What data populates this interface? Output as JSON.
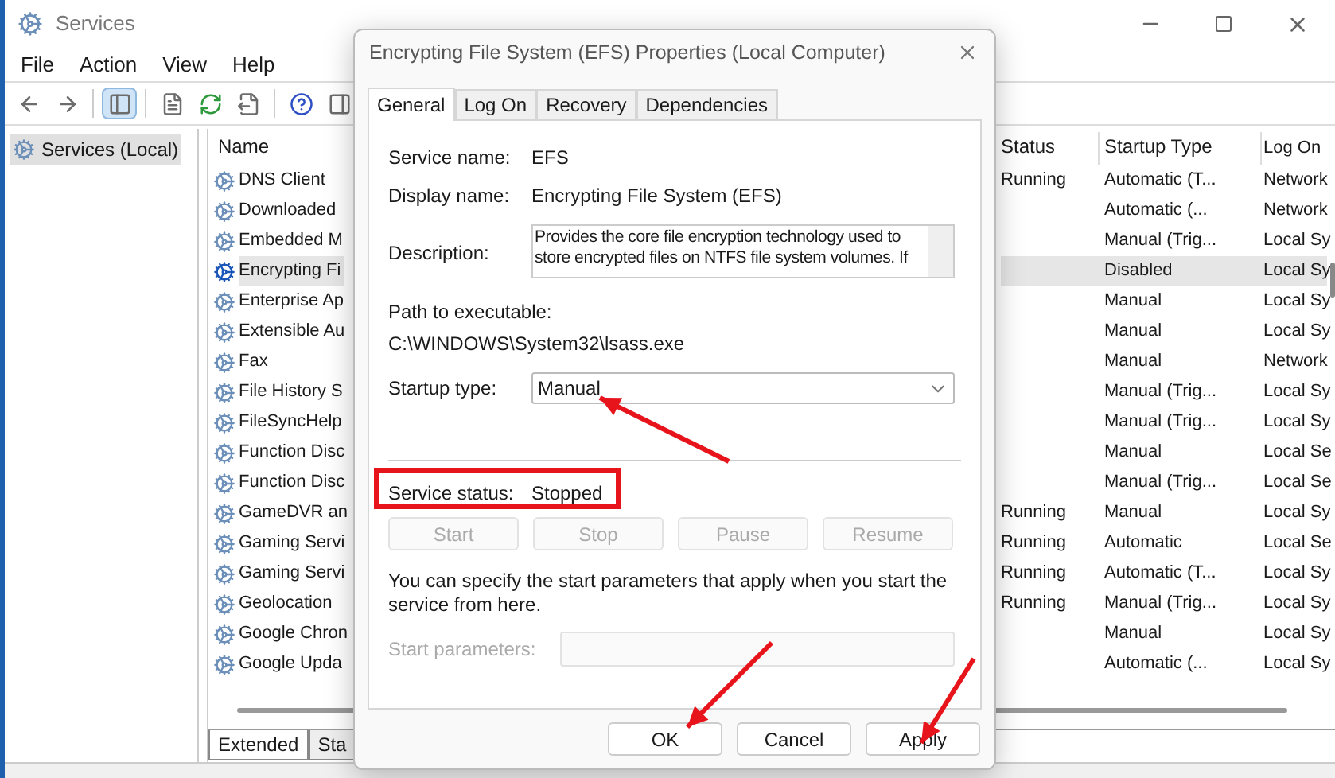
{
  "window": {
    "title": "Services"
  },
  "menu": [
    "File",
    "Action",
    "View",
    "Help"
  ],
  "toolbar": [
    {
      "kind": "back",
      "selected": false
    },
    {
      "kind": "forward",
      "selected": false
    },
    {
      "kind": "separator"
    },
    {
      "kind": "console-tree",
      "selected": true
    },
    {
      "kind": "separator"
    },
    {
      "kind": "properties",
      "selected": false
    },
    {
      "kind": "refresh",
      "selected": false
    },
    {
      "kind": "export",
      "selected": false
    },
    {
      "kind": "separator"
    },
    {
      "kind": "help",
      "selected": false
    },
    {
      "kind": "action-pane",
      "selected": false
    }
  ],
  "tree": [
    {
      "label": "Services (Local)",
      "selected": true
    }
  ],
  "table": {
    "columns": [
      "Name",
      "Status",
      "Startup Type",
      "Log On"
    ],
    "rows": [
      {
        "name": "DNS Client",
        "status": "Running",
        "startup_type": "Automatic (T...",
        "log_on": "Network",
        "selected": false
      },
      {
        "name": "Downloaded",
        "startup_type": "Automatic (...",
        "log_on": "Network",
        "selected": false
      },
      {
        "name": "Embedded M",
        "startup_type": "Manual (Trig...",
        "log_on": "Local Sy",
        "selected": false
      },
      {
        "name": "Encrypting Fi",
        "startup_type": "Disabled",
        "log_on": "Local Sy",
        "selected": true
      },
      {
        "name": "Enterprise Ap",
        "startup_type": "Manual",
        "log_on": "Local Sy",
        "selected": false
      },
      {
        "name": "Extensible Au",
        "startup_type": "Manual",
        "log_on": "Local Sy",
        "selected": false
      },
      {
        "name": "Fax",
        "startup_type": "Manual",
        "log_on": "Network",
        "selected": false
      },
      {
        "name": "File History S",
        "startup_type": "Manual (Trig...",
        "log_on": "Local Sy",
        "selected": false
      },
      {
        "name": "FileSyncHelp",
        "startup_type": "Manual (Trig...",
        "log_on": "Local Sy",
        "selected": false
      },
      {
        "name": "Function Disc",
        "startup_type": "Manual",
        "log_on": "Local Se",
        "selected": false
      },
      {
        "name": "Function Disc",
        "startup_type": "Manual (Trig...",
        "log_on": "Local Se",
        "selected": false
      },
      {
        "name": "GameDVR an",
        "status": "Running",
        "startup_type": "Manual",
        "log_on": "Local Sy",
        "selected": false
      },
      {
        "name": "Gaming Servi",
        "status": "Running",
        "startup_type": "Automatic",
        "log_on": "Local Se",
        "selected": false
      },
      {
        "name": "Gaming Servi",
        "status": "Running",
        "startup_type": "Automatic (T...",
        "log_on": "Local Sy",
        "selected": false
      },
      {
        "name": "Geolocation",
        "status": "Running",
        "startup_type": "Manual (Trig...",
        "log_on": "Local Sy",
        "selected": false
      },
      {
        "name": "Google Chron",
        "startup_type": "Manual",
        "log_on": "Local Sy",
        "selected": false
      },
      {
        "name": "Google Upda",
        "startup_type": "Automatic (...",
        "log_on": "Local Sy",
        "selected": false
      }
    ]
  },
  "view_tabs": [
    {
      "label": "Extended",
      "selected": true
    },
    {
      "label": "Sta",
      "selected": false
    }
  ],
  "dialog": {
    "title": "Encrypting File System (EFS) Properties (Local Computer)",
    "tabs": [
      {
        "label": "General",
        "selected": true
      },
      {
        "label": "Log On",
        "selected": false
      },
      {
        "label": "Recovery",
        "selected": false
      },
      {
        "label": "Dependencies",
        "selected": false
      }
    ],
    "service_name": {
      "label": "Service name:",
      "value": "EFS"
    },
    "display_name": {
      "label": "Display name:",
      "value": "Encrypting File System (EFS)"
    },
    "description": {
      "label": "Description:",
      "value": "Provides the core file encryption technology used to store encrypted files on NTFS file system volumes. If"
    },
    "path": {
      "label": "Path to executable:",
      "value": "C:\\WINDOWS\\System32\\lsass.exe"
    },
    "startup_type": {
      "label": "Startup type:",
      "value": "Manual"
    },
    "service_status": {
      "label": "Service status:",
      "value": "Stopped"
    },
    "control_buttons": [
      {
        "label": "Start",
        "disabled": true
      },
      {
        "label": "Stop",
        "disabled": true
      },
      {
        "label": "Pause",
        "disabled": true
      },
      {
        "label": "Resume",
        "disabled": true
      }
    ],
    "hint": "You can specify the start parameters that apply when you start the service from here.",
    "start_parameters": {
      "label": "Start parameters:",
      "disabled": true
    },
    "buttons": [
      "OK",
      "Cancel",
      "Apply"
    ]
  }
}
